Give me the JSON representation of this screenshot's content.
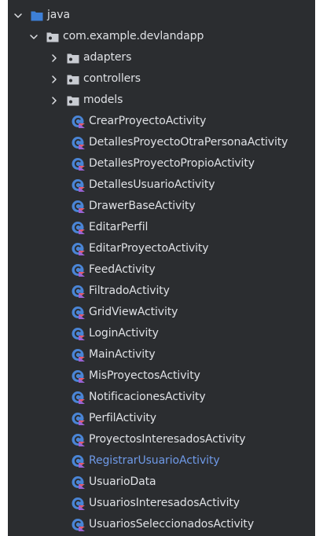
{
  "colors": {
    "panel_bg": "#2b2d30",
    "text": "#dfe1e5",
    "highlight_text": "#6f9ae8",
    "folder_blue": "#3d7fd6",
    "package_gray": "#c9ccd2",
    "class_blue": "#4a85d6",
    "class_mark": "#e35a6b"
  },
  "tree": {
    "root": {
      "label": "java",
      "icon": "folder-icon",
      "expanded": true
    },
    "package": {
      "label": "com.example.devlandapp",
      "icon": "package-icon",
      "expanded": true
    },
    "subpackages": [
      {
        "label": "adapters",
        "icon": "package-icon",
        "expanded": false
      },
      {
        "label": "controllers",
        "icon": "package-icon",
        "expanded": false
      },
      {
        "label": "models",
        "icon": "package-icon",
        "expanded": false
      }
    ],
    "classes": [
      {
        "label": "CrearProyectoActivity",
        "icon": "kotlin-class-icon"
      },
      {
        "label": "DetallesProyectoOtraPersonaActivity",
        "icon": "kotlin-class-icon"
      },
      {
        "label": "DetallesProyectoPropioActivity",
        "icon": "kotlin-class-icon"
      },
      {
        "label": "DetallesUsuarioActivity",
        "icon": "kotlin-class-icon"
      },
      {
        "label": "DrawerBaseActivity",
        "icon": "kotlin-class-icon"
      },
      {
        "label": "EditarPerfil",
        "icon": "kotlin-class-icon"
      },
      {
        "label": "EditarProyectoActivity",
        "icon": "kotlin-class-icon"
      },
      {
        "label": "FeedActivity",
        "icon": "kotlin-class-icon"
      },
      {
        "label": "FiltradoActivity",
        "icon": "kotlin-class-icon"
      },
      {
        "label": "GridViewActivity",
        "icon": "kotlin-class-icon"
      },
      {
        "label": "LoginActivity",
        "icon": "kotlin-class-icon"
      },
      {
        "label": "MainActivity",
        "icon": "kotlin-class-icon"
      },
      {
        "label": "MisProyectosActivity",
        "icon": "kotlin-class-icon"
      },
      {
        "label": "NotificacionesActivity",
        "icon": "kotlin-class-icon"
      },
      {
        "label": "PerfilActivity",
        "icon": "kotlin-class-icon"
      },
      {
        "label": "ProyectosInteresadosActivity",
        "icon": "kotlin-class-icon"
      },
      {
        "label": "RegistrarUsuarioActivity",
        "icon": "kotlin-class-icon",
        "highlighted": true
      },
      {
        "label": "UsuarioData",
        "icon": "kotlin-class-icon"
      },
      {
        "label": "UsuariosInteresadosActivity",
        "icon": "kotlin-class-icon"
      },
      {
        "label": "UsuariosSeleccionadosActivity",
        "icon": "kotlin-class-icon"
      }
    ]
  }
}
